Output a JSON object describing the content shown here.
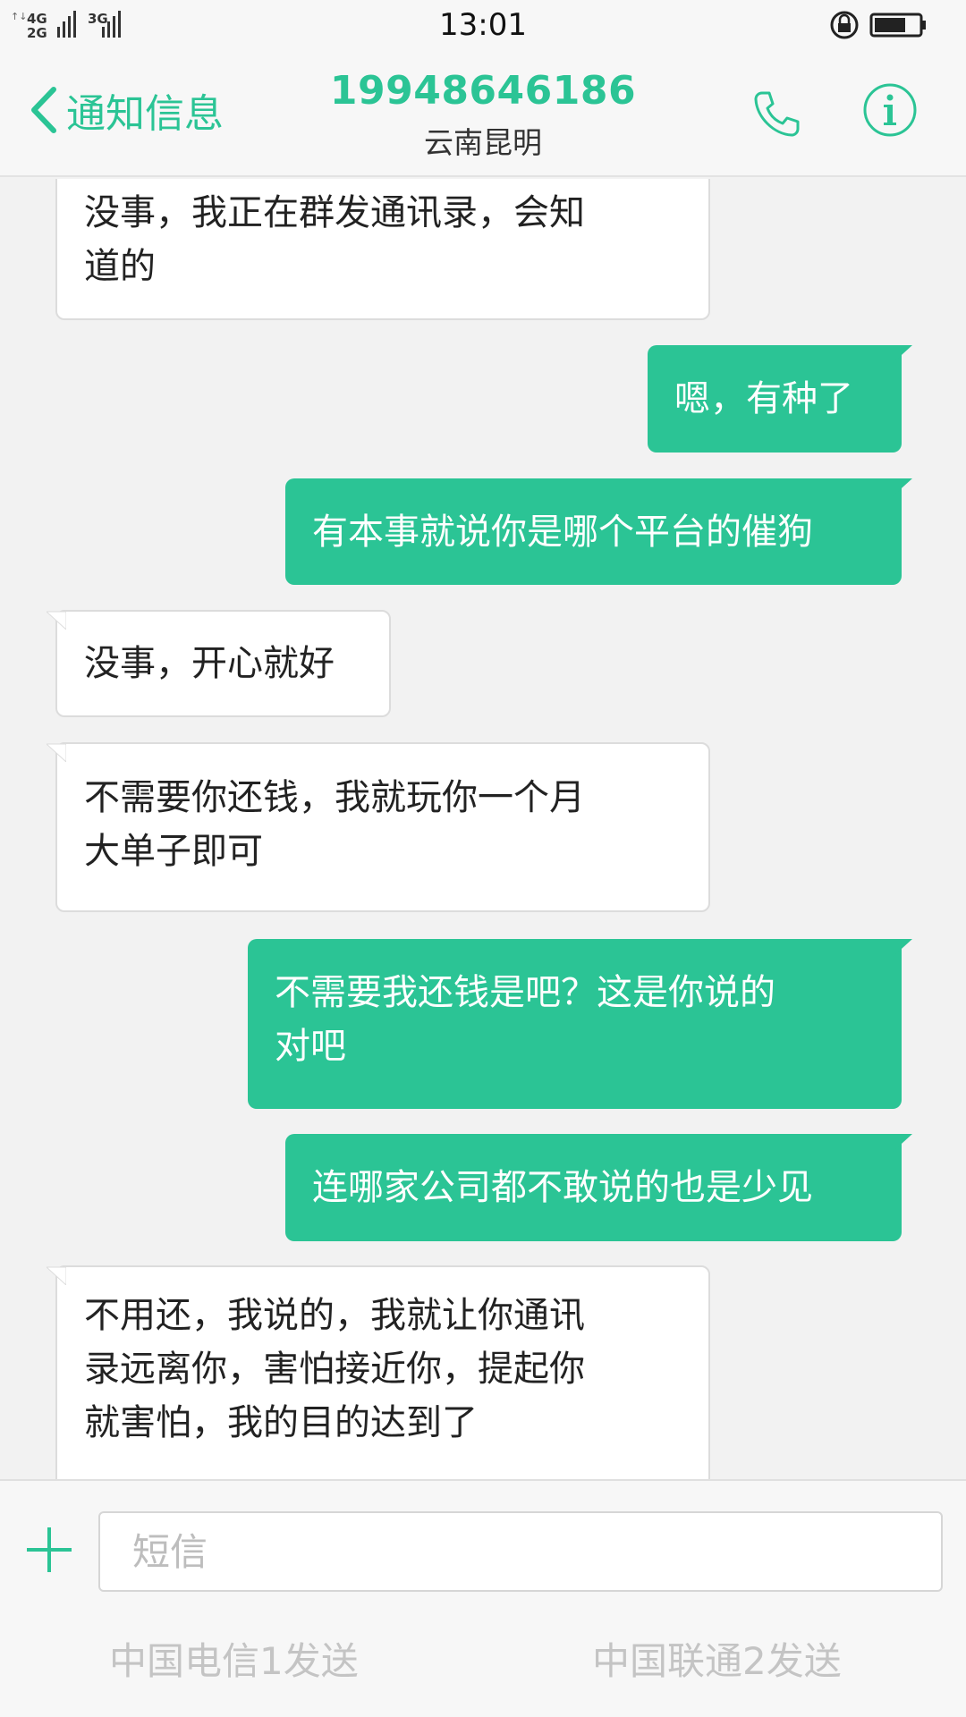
{
  "status_bar": {
    "time": "13:01",
    "network_1": "4G",
    "network_2": "2G",
    "network_3": "3G",
    "battery_icon": "battery-icon",
    "lock_icon": "rotation-lock-icon"
  },
  "header": {
    "back_label": "通知信息",
    "contact_number": "19948646186",
    "contact_location": "云南昆明",
    "call_icon": "phone-icon",
    "info_icon": "info-icon"
  },
  "messages": [
    {
      "side": "in",
      "lines": [
        "没事，我正在群发通讯录，会知",
        "道的"
      ]
    },
    {
      "side": "out",
      "lines": [
        "嗯，有种了"
      ]
    },
    {
      "side": "out",
      "lines": [
        "有本事就说你是哪个平台的催狗"
      ]
    },
    {
      "side": "in",
      "lines": [
        "没事，开心就好"
      ]
    },
    {
      "side": "in",
      "lines": [
        "不需要你还钱，我就玩你一个月",
        "大单子即可"
      ]
    },
    {
      "side": "out",
      "lines": [
        "不需要我还钱是吧？这是你说的",
        "对吧"
      ]
    },
    {
      "side": "out",
      "lines": [
        "连哪家公司都不敢说的也是少见"
      ]
    },
    {
      "side": "in",
      "lines": [
        "不用还，我说的，我就让你通讯",
        "录远离你，害怕接近你，提起你",
        "就害怕，我的目的达到了"
      ]
    }
  ],
  "composer": {
    "placeholder": "短信",
    "value": "",
    "send_sim1_label": "中国电信1发送",
    "send_sim2_label": "中国联通2发送",
    "add_icon": "plus-icon"
  },
  "colors": {
    "accent": "#2bc495",
    "incoming_bubble": "#ffffff",
    "background": "#f2f2f2"
  }
}
